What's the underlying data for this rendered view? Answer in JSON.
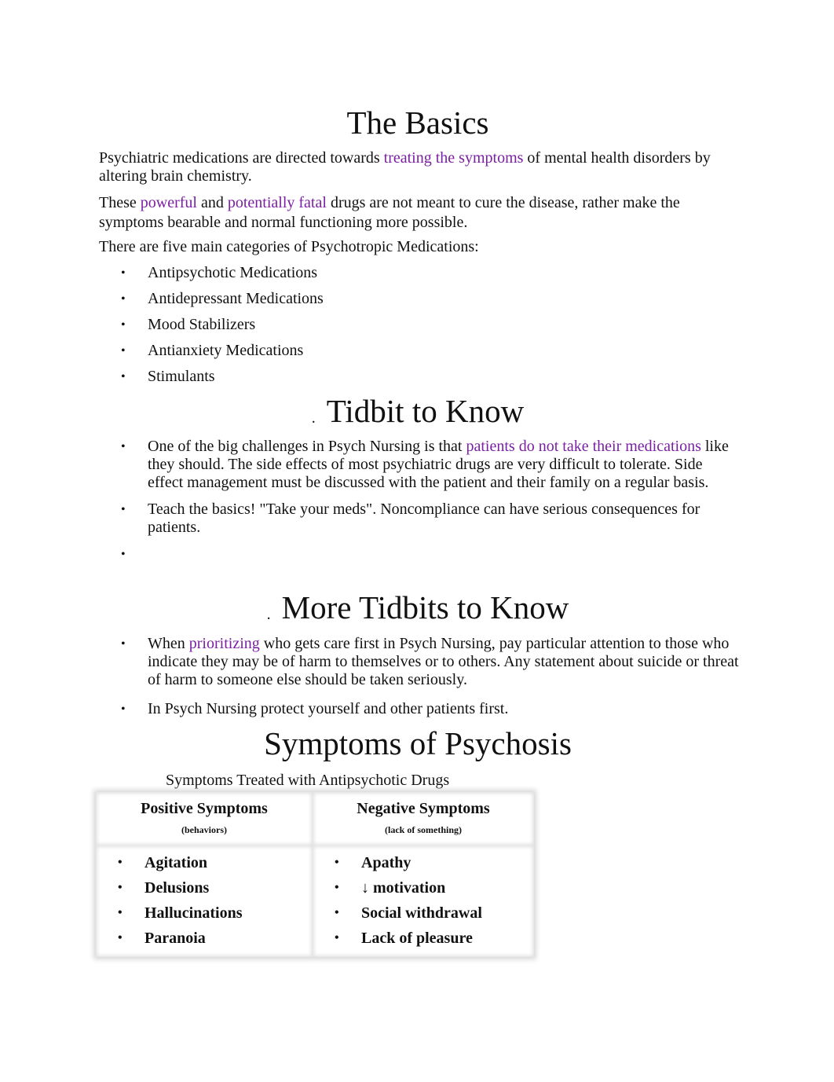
{
  "basics": {
    "title": "The Basics",
    "p1": {
      "a": "Psychiatric medications are directed towards",
      "hl": "treating the symptoms",
      "b": " of mental health disorders by altering brain chemistry."
    },
    "p2": {
      "a": "These ",
      "hl1": "powerful",
      "b": " and ",
      "hl2": "potentially fatal",
      "c": " drugs are not meant to cure the disease, rather make the symptoms bearable and normal functioning more possible."
    },
    "p3": "There are five main categories of Psychotropic Medications:",
    "categories": [
      "Antipsychotic Medications",
      "Antidepressant Medications",
      "Mood Stabilizers",
      "Antianxiety Medications",
      "Stimulants"
    ]
  },
  "tidbit": {
    "bullet": ".",
    "title": "Tidbit to Know",
    "item1": {
      "a": "One of the big challenges in Psych Nursing is that ",
      "hl": "patients do not take their medications",
      "b": " like they should. The side effects of most psychiatric drugs are very difficult to tolerate. Side effect management must be discussed with the patient and their family on a regular basis."
    },
    "item2": "Teach the basics! \"Take your meds\". Noncompliance can have serious consequences for patients.",
    "item3": ""
  },
  "more": {
    "bullet": ".",
    "title": "More Tidbits to Know",
    "item1": {
      "a": "When ",
      "hl": "prioritizing",
      "b": " who gets care first in Psych Nursing, pay particular attention to those who indicate they may be of harm to themselves or to others. Any statement about suicide or threat of harm to someone else should be taken seriously."
    },
    "item2": "In Psych Nursing protect yourself and other patients first."
  },
  "psychosis": {
    "title": "Symptoms of Psychosis",
    "caption": "Symptoms Treated with Antipsychotic Drugs",
    "positive": {
      "title": "Positive Symptoms",
      "sub": "(behaviors)",
      "items": [
        "Agitation",
        "Delusions",
        "Hallucinations",
        "Paranoia"
      ]
    },
    "negative": {
      "title": "Negative Symptoms",
      "sub": "(lack of something)",
      "items": [
        "Apathy",
        "↓ motivation",
        "Social withdrawal",
        "Lack of pleasure"
      ]
    }
  }
}
